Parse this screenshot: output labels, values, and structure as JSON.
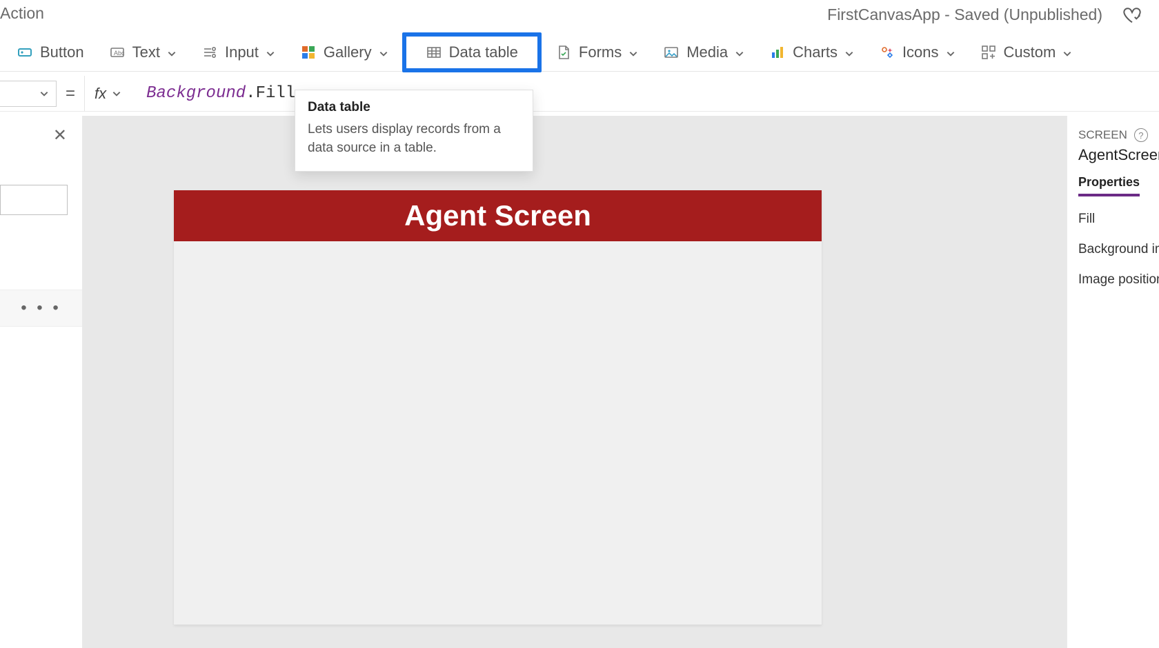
{
  "title": {
    "left_tab": "Action",
    "app_status": "FirstCanvasApp - Saved (Unpublished)"
  },
  "ribbon": {
    "button": "Button",
    "text": "Text",
    "input": "Input",
    "gallery": "Gallery",
    "data_table": "Data table",
    "forms": "Forms",
    "media": "Media",
    "charts": "Charts",
    "icons": "Icons",
    "custom": "Custom"
  },
  "tooltip": {
    "title": "Data table",
    "body": "Lets users display records from a data source in a table."
  },
  "formula": {
    "eq": "=",
    "fx": "fx",
    "object": "Background",
    "dot": ".",
    "property": "Fill"
  },
  "canvas": {
    "header": "Agent Screen"
  },
  "left": {
    "ellipsis": "• • •"
  },
  "right": {
    "label": "SCREEN",
    "help": "?",
    "name": "AgentScreen",
    "tab": "Properties",
    "rows": {
      "fill": "Fill",
      "bg": "Background image",
      "imgpos": "Image position"
    }
  }
}
